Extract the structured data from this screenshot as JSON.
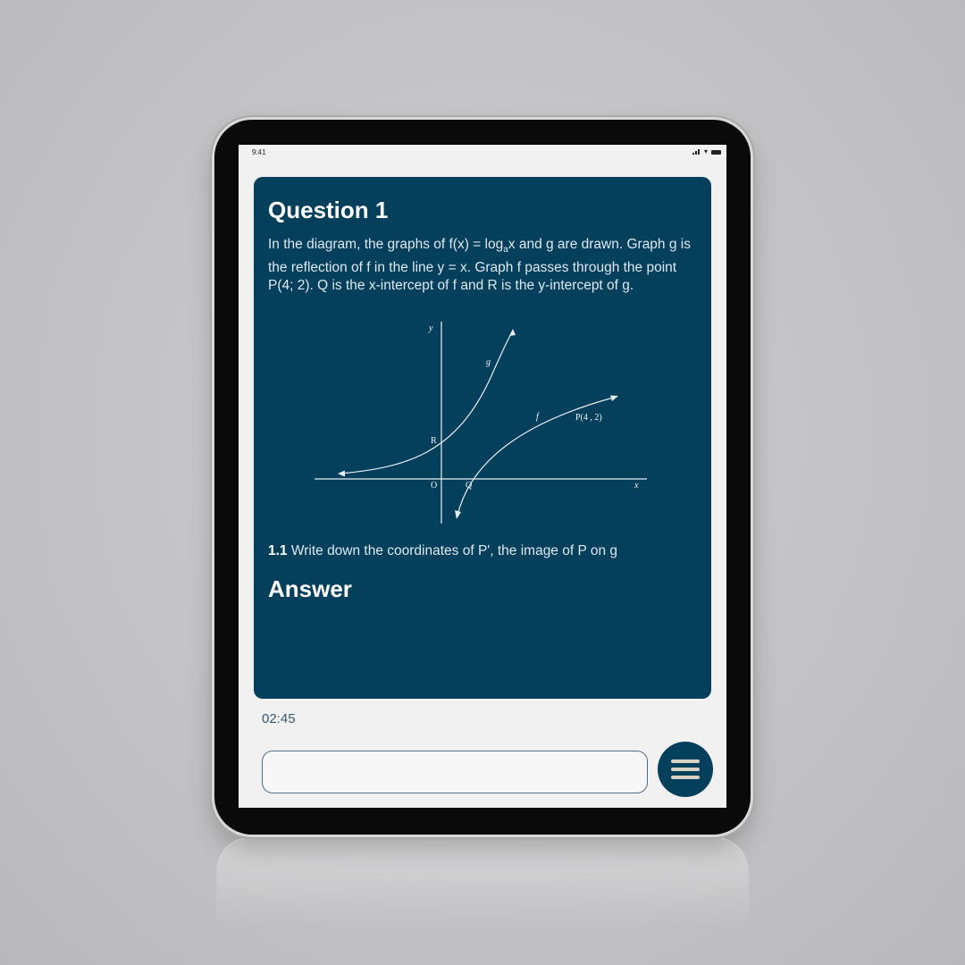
{
  "status_bar": {
    "time": "9:41"
  },
  "question": {
    "title": "Question 1",
    "intro_pre": "In the diagram, the graphs of  f(x) = log",
    "intro_sub": "a",
    "intro_post": "x and g are drawn. Graph g is the reflection of f in the line y = x. Graph f passes through the point P(4; 2). Q is the x-intercept of f and R is the y-intercept of g.",
    "diagram_labels": {
      "y_axis": "y",
      "x_axis": "x",
      "origin": "O",
      "g": "g",
      "f": "f",
      "r": "R",
      "q": "Q",
      "p": "P(4 , 2)"
    },
    "sub_number": "1.1",
    "sub_text": "Write down the coordinates of P', the image of P on g",
    "answer_heading": "Answer"
  },
  "timer": "02:45",
  "answer_input": {
    "value": "",
    "placeholder": ""
  },
  "menu_button": {
    "icon": "hamburger-menu-icon"
  },
  "colors": {
    "card": "#043f5c",
    "screen": "#f1f1f1",
    "menu_bars": "#d9d2c4"
  }
}
